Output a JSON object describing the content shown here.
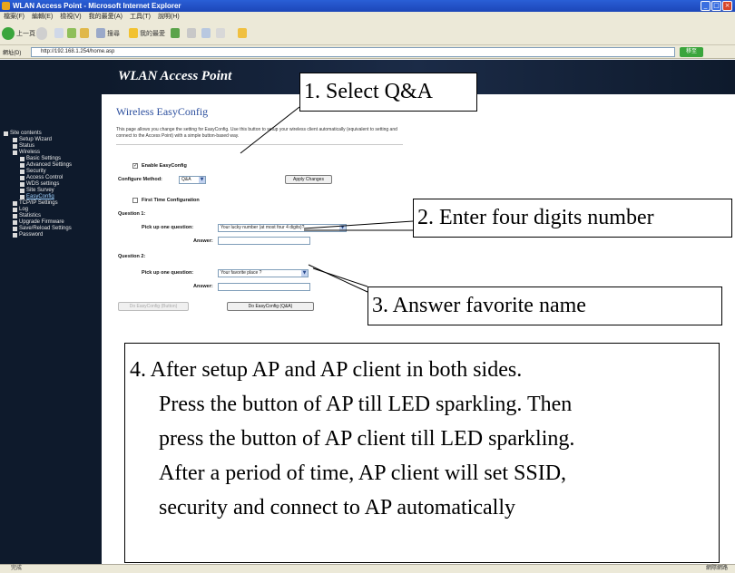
{
  "browser": {
    "title": "WLAN Access Point - Microsoft Internet Explorer",
    "menu": [
      "檔案(F)",
      "編輯(E)",
      "檢視(V)",
      "我的最愛(A)",
      "工具(T)",
      "說明(H)"
    ],
    "toolbar": {
      "back_label": "上一頁",
      "search_label": "搜尋",
      "favorites_label": "我的最愛"
    },
    "address_label": "網址(D)",
    "address_value": "http://192.168.1.254/home.asp",
    "go_label": "移至",
    "status_left": "完成",
    "status_right": "網際網路"
  },
  "sidebar": {
    "items": [
      {
        "label": "Site contents",
        "level": 0
      },
      {
        "label": "Setup Wizard",
        "level": 1
      },
      {
        "label": "Status",
        "level": 1
      },
      {
        "label": "Wireless",
        "level": 1
      },
      {
        "label": "Basic Settings",
        "level": 2
      },
      {
        "label": "Advanced Settings",
        "level": 2
      },
      {
        "label": "Security",
        "level": 2
      },
      {
        "label": "Access Control",
        "level": 2
      },
      {
        "label": "WDS settings",
        "level": 2
      },
      {
        "label": "Site Survey",
        "level": 2
      },
      {
        "label": "EasyConfig",
        "level": 2,
        "active": true
      },
      {
        "label": "TCP/IP Settings",
        "level": 1
      },
      {
        "label": "Log",
        "level": 1
      },
      {
        "label": "Statistics",
        "level": 1
      },
      {
        "label": "Upgrade Firmware",
        "level": 1
      },
      {
        "label": "Save/Reload Settings",
        "level": 1
      },
      {
        "label": "Password",
        "level": 1
      }
    ]
  },
  "banner": {
    "title": "WLAN Access Point"
  },
  "form": {
    "title": "Wireless EasyConfig",
    "description": "This page allows you change the setting for EasyConfig. Use this button to setup your wireless client automatically (equivalent to setting and connect to the Access Point) with a simple button-based way.",
    "enable_label": "Enable EasyConfig",
    "method_label": "Configure Method:",
    "method_value": "Q&A",
    "apply_label": "Apply Changes",
    "first_time_label": "First Time Configuration",
    "q1_label": "Question 1:",
    "q1_pick_label": "Pick up one question:",
    "q1_value": "Your lucky number (at most four 4 digits)?",
    "q1_answer_label": "Answer:",
    "q2_label": "Question 2:",
    "q2_pick_label": "Pick up one question:",
    "q2_value": "Your favorite place ?",
    "q2_answer_label": "Answer:",
    "btn_button_label": "Do EasyConfig (Button)",
    "btn_qa_label": "Do EasyConfig (Q&A)"
  },
  "callouts": {
    "step1": "1. Select Q&A",
    "step2": "2. Enter four digits number",
    "step3": "3. Answer favorite name",
    "step4": [
      "4. After setup AP and AP client in both sides.",
      "Press the button of AP till LED sparkling. Then",
      "press the button of AP client till LED sparkling.",
      "After a period of time, AP client will set SSID,",
      "security and connect to AP automatically"
    ]
  }
}
